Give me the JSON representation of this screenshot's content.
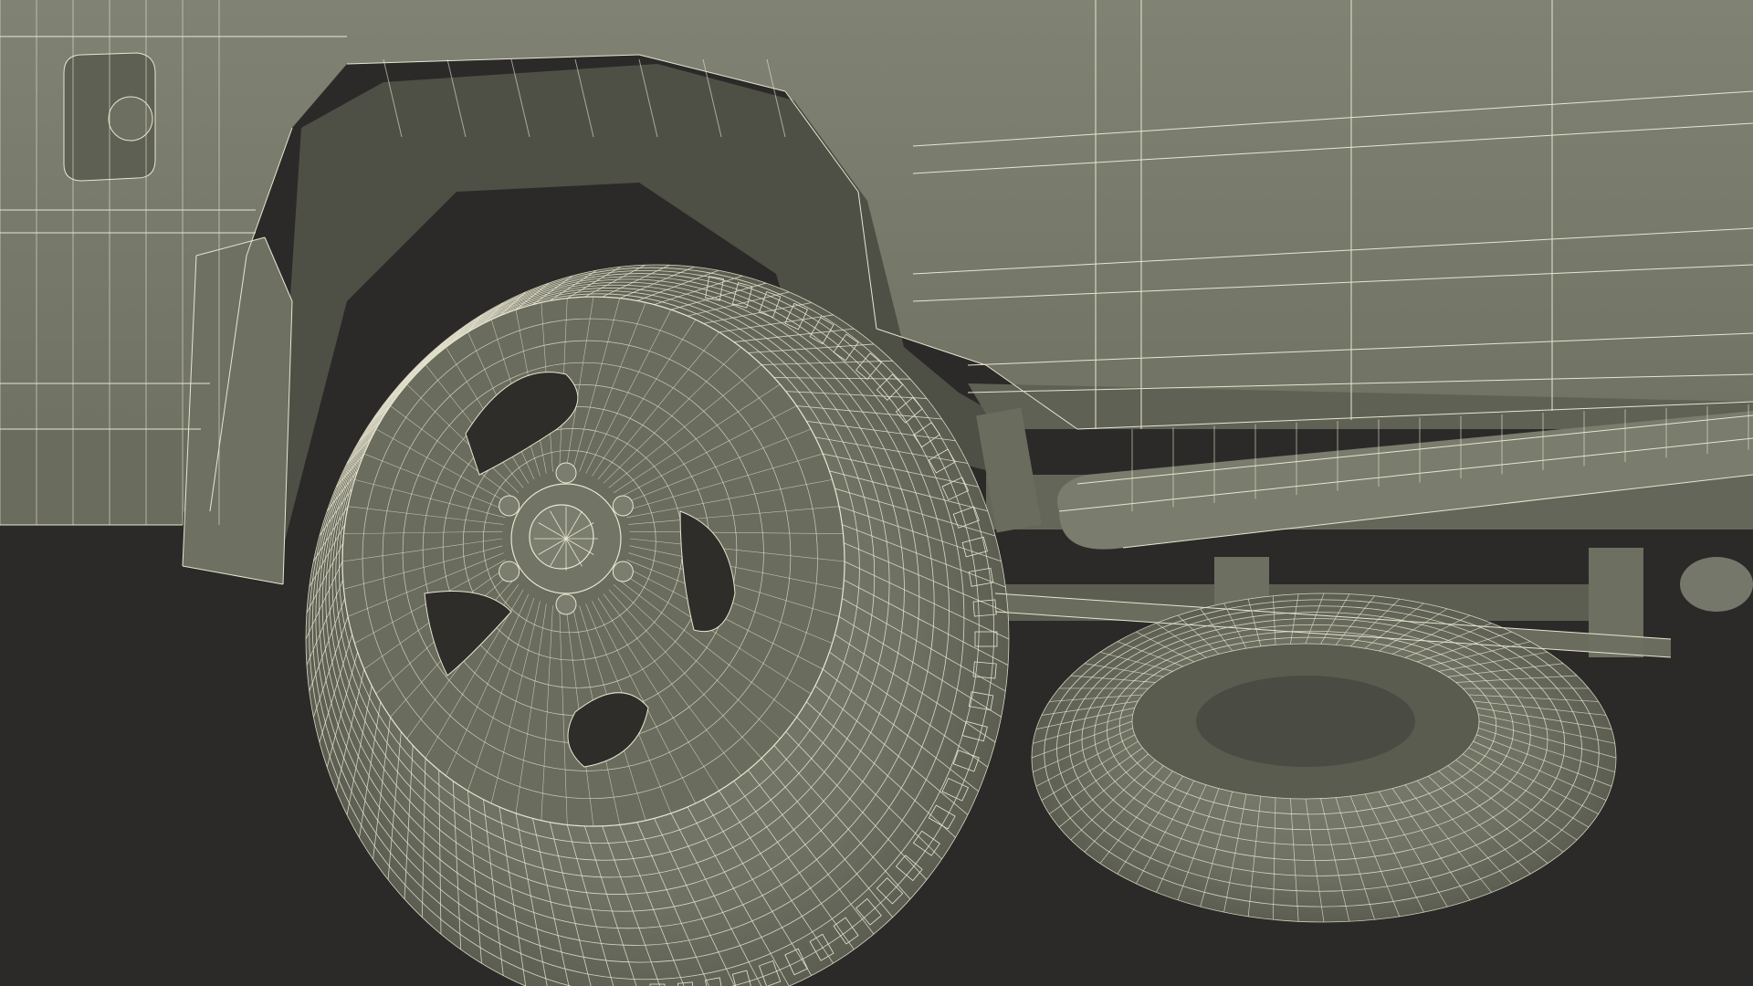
{
  "scene": {
    "subject": "wireframe-render",
    "colors": {
      "background": "#2b2a28",
      "body": "#7a7c6d",
      "body_dark": "#5f6154",
      "wheel_well": "#4e5046",
      "tire": "#6f7163",
      "rim": "#6a6c5e",
      "wire": "#e8e6d0",
      "wire_dim": "#c9c8b2",
      "hole": "#2e2d2a"
    }
  }
}
